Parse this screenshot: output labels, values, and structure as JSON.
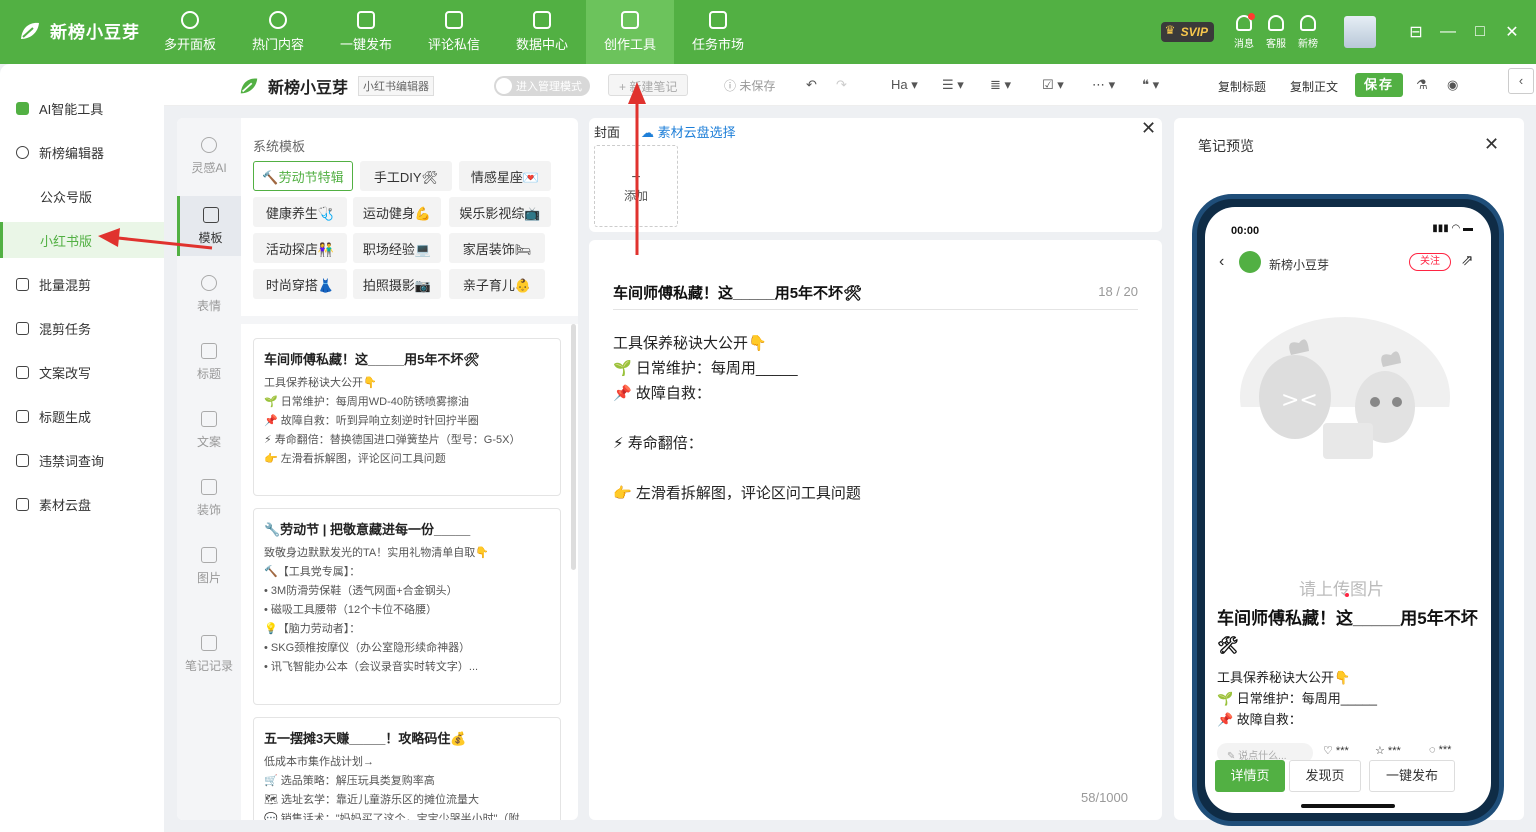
{
  "topbar": {
    "brand": "新榜小豆芽",
    "nav": [
      {
        "label": "多开面板",
        "icon": "user-icon"
      },
      {
        "label": "热门内容",
        "icon": "flame-icon"
      },
      {
        "label": "一键发布",
        "icon": "publish-icon"
      },
      {
        "label": "评论私信",
        "icon": "chat-icon"
      },
      {
        "label": "数据中心",
        "icon": "data-icon"
      },
      {
        "label": "创作工具",
        "icon": "toolbox-icon"
      },
      {
        "label": "任务市场",
        "icon": "task-icon"
      }
    ],
    "active_nav": "创作工具",
    "vip_badge": "SVIP",
    "tools": [
      {
        "label": "消息",
        "icon": "bell-icon"
      },
      {
        "label": "客服",
        "icon": "headset-icon"
      },
      {
        "label": "新榜",
        "icon": "rank-icon"
      }
    ],
    "accent": "#52b043"
  },
  "sidebar": {
    "items": [
      {
        "label": "AI智能工具",
        "icon": "ai-icon"
      },
      {
        "label": "新榜编辑器",
        "icon": "editor-icon"
      },
      {
        "label": "公众号版",
        "icon": ""
      },
      {
        "label": "小红书版",
        "icon": ""
      },
      {
        "label": "批量混剪",
        "icon": "batch-cut-icon"
      },
      {
        "label": "混剪任务",
        "icon": "cut-task-icon"
      },
      {
        "label": "文案改写",
        "icon": "rewrite-icon"
      },
      {
        "label": "标题生成",
        "icon": "title-gen-icon"
      },
      {
        "label": "违禁词查询",
        "icon": "forbidden-icon"
      },
      {
        "label": "素材云盘",
        "icon": "folder-icon"
      }
    ],
    "active": "小红书版"
  },
  "editor_bar": {
    "brand": "新榜小豆芽",
    "tag": "小红书编辑器",
    "toggle_label": "进入管理模式",
    "new_note": "+ 新建笔记",
    "unsaved": "未保存",
    "heading_label": "Ha",
    "copy_title": "复制标题",
    "copy_body": "复制正文",
    "save": "保存"
  },
  "template_panel": {
    "rail": [
      {
        "label": "灵感AI",
        "icon": "bulb-icon"
      },
      {
        "label": "模板",
        "icon": "template-icon"
      },
      {
        "label": "表情",
        "icon": "emoji-icon"
      },
      {
        "label": "标题",
        "icon": "heading-icon"
      },
      {
        "label": "文案",
        "icon": "pen-icon"
      },
      {
        "label": "装饰",
        "icon": "sparkle-icon"
      },
      {
        "label": "图片",
        "icon": "image-icon"
      },
      {
        "label": "笔记记录",
        "icon": "notes-icon"
      }
    ],
    "active_rail": "模板",
    "section_title": "系统模板",
    "chips": [
      "🔨劳动节特辑",
      "手工DIY🛠",
      "情感星座💌",
      "健康养生🩺",
      "运动健身💪",
      "娱乐影视综📺",
      "活动探店👫",
      "职场经验💻",
      "家居装饰🛏",
      "时尚穿搭👗",
      "拍照摄影📷",
      "亲子育儿👶"
    ],
    "active_chip": "🔨劳动节特辑",
    "cards": [
      {
        "title": "车间师傅私藏！这_____用5年不坏🛠",
        "lines": [
          "工具保养秘诀大公开👇",
          "🌱 日常维护：每周用WD-40防锈喷雾擦油",
          "📌 故障自救：听到异响立刻逆时针回拧半圈",
          "⚡ 寿命翻倍：替换德国进口弹簧垫片（型号：G-5X）",
          "👉 左滑看拆解图，评论区问工具问题"
        ]
      },
      {
        "title": "🔧劳动节 | 把敬意藏进每一份_____",
        "lines": [
          "致敬身边默默发光的TA！实用礼物清单自取👇",
          "🔨【工具党专属】：",
          "• 3M防滑劳保鞋（透气网面+合金钢头）",
          "• 磁吸工具腰带（12个卡位不硌腰）",
          "💡【脑力劳动者】：",
          "• SKG颈椎按摩仪（办公室隐形续命神器）",
          "• 讯飞智能办公本（会议录音实时转文字）..."
        ]
      },
      {
        "title": "五一摆摊3天赚_____！攻略码住💰",
        "lines": [
          "低成本市集作战计划→",
          "🛒 选品策略：解压玩具类复购率高",
          "🗺 选址玄学：靠近儿童游乐区的摊位流量大",
          "💬 销售话术：\"妈妈买了这个，宝宝少哭半小时\"（附..."
        ]
      }
    ]
  },
  "cover": {
    "label": "封面",
    "cloud_link": "素材云盘选择",
    "add_label": "添加"
  },
  "content": {
    "title": "车间师傅私藏！这_____用5年不坏🛠",
    "title_count": "18 / 20",
    "lines": [
      "工具保养秘诀大公开👇",
      "🌱 日常维护：每周用_____",
      "📌 故障自救：",
      "",
      "⚡ 寿命翻倍：",
      "",
      "👉 左滑看拆解图，评论区问工具问题"
    ],
    "body_count": "58/1000"
  },
  "preview": {
    "title": "笔记预览",
    "status_time": "00:00",
    "author": "新榜小豆芽",
    "follow": "关注",
    "placeholder": "请上传图片",
    "note_title": "车间师傅私藏！这_____用5年不坏🛠",
    "lines": [
      "工具保养秘诀大公开👇",
      "🌱 日常维护：每周用_____",
      "📌 故障自救："
    ],
    "comment_placeholder": "说点什么...",
    "stats": [
      "***",
      "***",
      "***"
    ],
    "tabs": [
      "详情页",
      "发现页",
      "一键发布"
    ],
    "active_tab": "详情页"
  }
}
